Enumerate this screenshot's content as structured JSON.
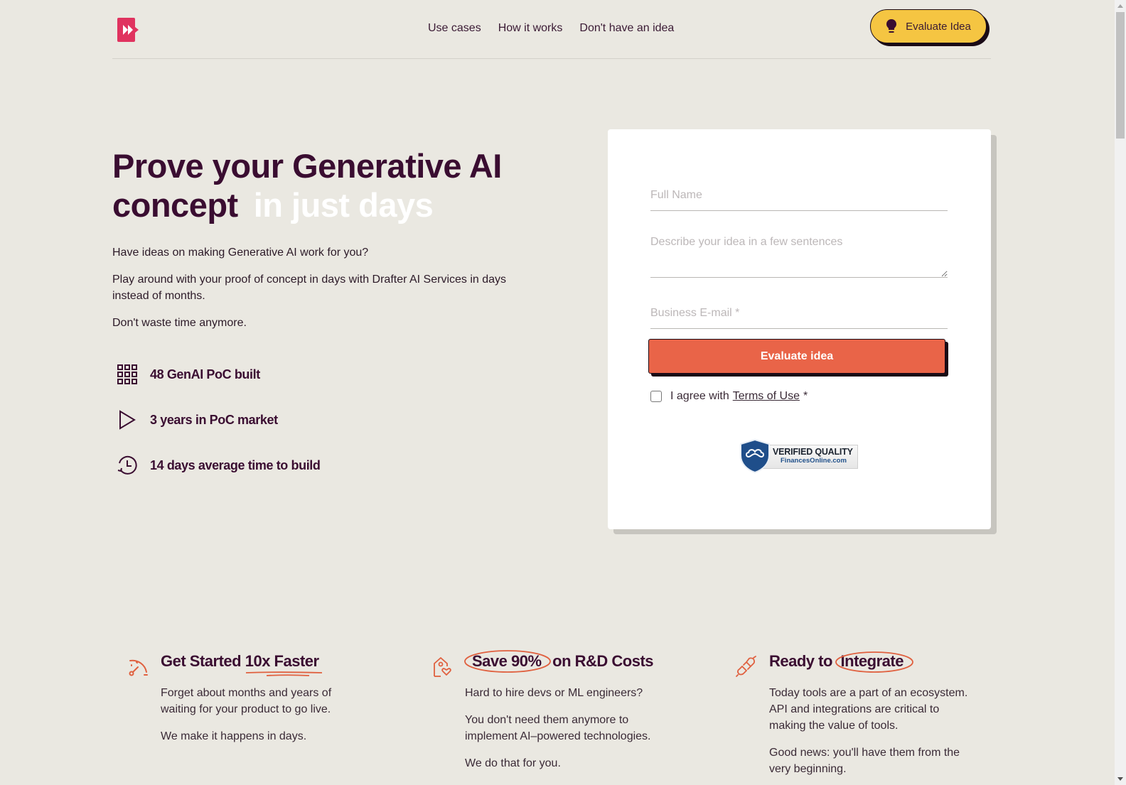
{
  "header": {
    "logo_alt": "Drafter AI logo",
    "nav": [
      "Use cases",
      "How it works",
      "Don't have an idea"
    ],
    "cta_label": "Evaluate Idea",
    "cta_icon": "lightbulb-icon"
  },
  "hero": {
    "title_main": "Prove your Generative AI concept",
    "title_accent": "in just days",
    "paragraphs": [
      "Have ideas on making Generative AI work for you?",
      "Play around with your proof of concept in days with Drafter AI Services in days instead of months.",
      "Don't waste time anymore."
    ],
    "stats": [
      {
        "icon": "grid-icon",
        "label": "48 GenAI PoC built"
      },
      {
        "icon": "play-icon",
        "label": "3 years in PoC market"
      },
      {
        "icon": "clock-history-icon",
        "label": "14 days average time to build"
      }
    ]
  },
  "form": {
    "full_name_placeholder": "Full Name",
    "full_name_value": "",
    "idea_placeholder": "Describe your idea in a few sentences",
    "idea_value": "",
    "email_placeholder": "Business E-mail *",
    "email_value": "",
    "submit_label": "Evaluate idea",
    "agree_prefix": "I agree with",
    "terms_link": "Terms of Use",
    "agree_suffix": "*",
    "agree_checked": false,
    "badge_line1": "VERIFIED QUALITY",
    "badge_line2": "FinancesOnline.com"
  },
  "features": [
    {
      "icon": "speedometer-icon",
      "title_plain": "Get Started",
      "title_highlight": "10x Faster",
      "title_after": "",
      "paragraphs": [
        "Forget about months and years of waiting for your product to go live.",
        "We make it happens in days."
      ]
    },
    {
      "icon": "home-heart-icon",
      "title_plain": "",
      "title_highlight": "Save 90%",
      "title_after": "on R&D Costs",
      "paragraphs": [
        "Hard to hire devs or ML engineers?",
        "You don't need them anymore to implement AI–powered technologies.",
        "We do that for you."
      ]
    },
    {
      "icon": "plug-icon",
      "title_plain": "Ready to",
      "title_highlight": "Integrate",
      "title_after": "",
      "paragraphs": [
        "Today tools are a part of an ecosystem. API and integrations are critical to making the value of tools.",
        "Good news: you'll have them from the very beginning."
      ]
    }
  ],
  "colors": {
    "background": "#eae8e1",
    "brand_pink": "#e0335f",
    "cta_yellow": "#f5c542",
    "submit_orange": "#e96448",
    "heading": "#3a0d31",
    "accent_stroke": "#e0603f"
  }
}
